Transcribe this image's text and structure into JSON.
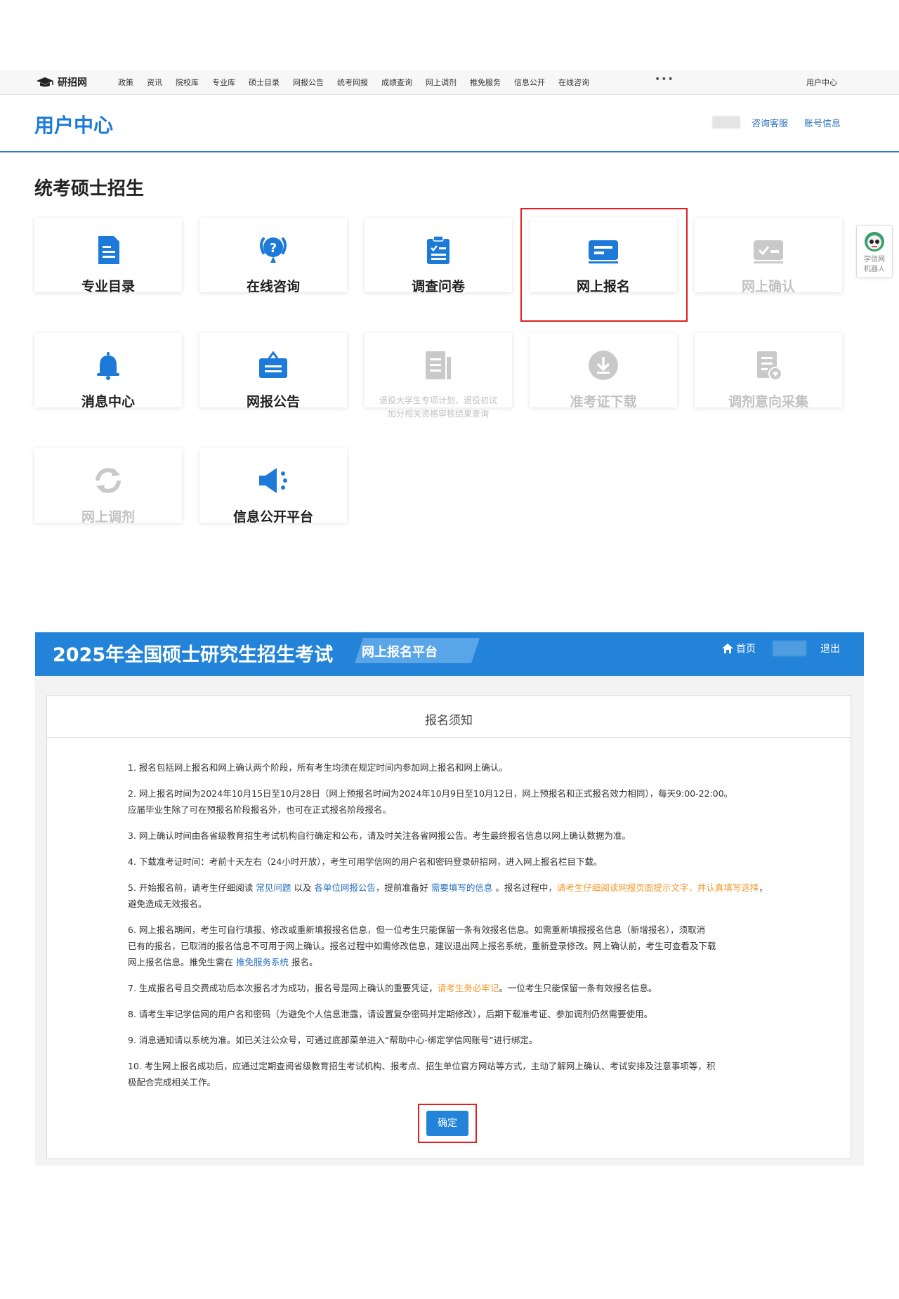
{
  "topnav": {
    "logo_text": "研招网",
    "items": [
      "政策",
      "资讯",
      "院校库",
      "专业库",
      "硕士目录",
      "网报公告",
      "统考网报",
      "成绩查询",
      "网上调剂",
      "推免服务",
      "信息公开",
      "在线咨询"
    ],
    "more": "•••",
    "user_center": "用户中心"
  },
  "header": {
    "title": "用户中心",
    "links": [
      "咨询客服",
      "账号信息"
    ]
  },
  "section": {
    "title": "统考硕士招生",
    "cards": [
      {
        "label": "专业目录",
        "icon": "catalog-icon",
        "enabled": true
      },
      {
        "label": "在线咨询",
        "icon": "consult-icon",
        "enabled": true
      },
      {
        "label": "调查问卷",
        "icon": "survey-icon",
        "enabled": true
      },
      {
        "label": "网上报名",
        "icon": "registration-icon",
        "enabled": true
      },
      {
        "label": "网上确认",
        "icon": "confirm-icon",
        "enabled": false
      },
      {
        "label": "消息中心",
        "icon": "bell-icon",
        "enabled": true
      },
      {
        "label": "网报公告",
        "icon": "announcement-icon",
        "enabled": true
      },
      {
        "label": "退役大学生专项计划、退役初试加分相关资格审核结果查询",
        "line1": "退役大学生专项计划、退役初试",
        "line2": "加分相关资格审核结果查询",
        "icon": "document-icon",
        "enabled": false
      },
      {
        "label": "准考证下载",
        "icon": "download-icon",
        "enabled": false
      },
      {
        "label": "调剂意向采集",
        "icon": "intent-icon",
        "enabled": false
      },
      {
        "label": "网上调剂",
        "icon": "refresh-icon",
        "enabled": false
      },
      {
        "label": "信息公开平台",
        "icon": "megaphone-icon",
        "enabled": true
      }
    ]
  },
  "robot": {
    "line1": "学信网",
    "line2": "机器人"
  },
  "registration": {
    "banner_title": "2025年全国硕士研究生招生考试",
    "platform": "网上报名平台",
    "home": "首页",
    "logout": "退出",
    "panel_title": "报名须知",
    "notes": {
      "n1": "1. 报名包括网上报名和网上确认两个阶段，所有考生均须在规定时间内参加网上报名和网上确认。",
      "n2a": "2. 网上报名时间为2024年10月15日至10月28日（网上预报名时间为2024年10月9日至10月12日，网上预报名和正式报名效力相同），每天9:00-22:00。",
      "n2b": "应届毕业生除了可在预报名阶段报名外，也可在正式报名阶段报名。",
      "n3": "3. 网上确认时间由各省级教育招生考试机构自行确定和公布，请及时关注各省网报公告。考生最终报名信息以网上确认数据为准。",
      "n4": "4. 下载准考证时间：考前十天左右（24小时开放），考生可用学信网的用户名和密码登录研招网，进入网上报名栏目下载。",
      "n5_pre": "5. 开始报名前，请考生仔细阅读 ",
      "n5_link1": "常见问题",
      "n5_mid1": " 以及 ",
      "n5_link2": "各单位网报公告",
      "n5_mid2": "，提前准备好 ",
      "n5_link3": "需要填写的信息",
      "n5_mid3": " 。报名过程中，",
      "n5_warn": "请考生仔细阅读网报页面提示文字，并认真填写选择",
      "n5_post": "，避免造成无效报名。",
      "n6a": "6. 网上报名期间，考生可自行填报、修改或重新填报报名信息，但一位考生只能保留一条有效报名信息。如需重新填报报名信息（新增报名），须取消",
      "n6b": "已有的报名，已取消的报名信息不可用于网上确认。报名过程中如需修改信息，建议退出网上报名系统，重新登录修改。网上确认前，考生可查看及下载",
      "n6c_pre": "网上报名信息。推免生需在 ",
      "n6c_link": "推免服务系统",
      "n6c_post": " 报名。",
      "n7_pre": "7. 生成报名号且交费成功后本次报名才为成功，报名号是网上确认的重要凭证，",
      "n7_warn": "请考生务必牢记",
      "n7_post": "。一位考生只能保留一条有效报名信息。",
      "n8": "8. 请考生牢记学信网的用户名和密码（为避免个人信息泄露，请设置复杂密码并定期修改），后期下载准考证、参加调剂仍然需要使用。",
      "n9": "9. 消息通知请以系统为准。如已关注公众号，可通过底部菜单进入“帮助中心-绑定学信网账号”进行绑定。",
      "n10a": "10. 考生网上报名成功后，应通过定期查阅省级教育招生考试机构、报考点、招生单位官方网站等方式，主动了解网上确认、考试安排及注意事项等，积",
      "n10b": "极配合完成相关工作。"
    },
    "confirm_button": "确定"
  },
  "colors": {
    "accent": "#2283d8",
    "highlight": "#e02020",
    "disabled": "#c2c2c2",
    "link": "#2a6fbf",
    "warning": "#f29a2e"
  }
}
